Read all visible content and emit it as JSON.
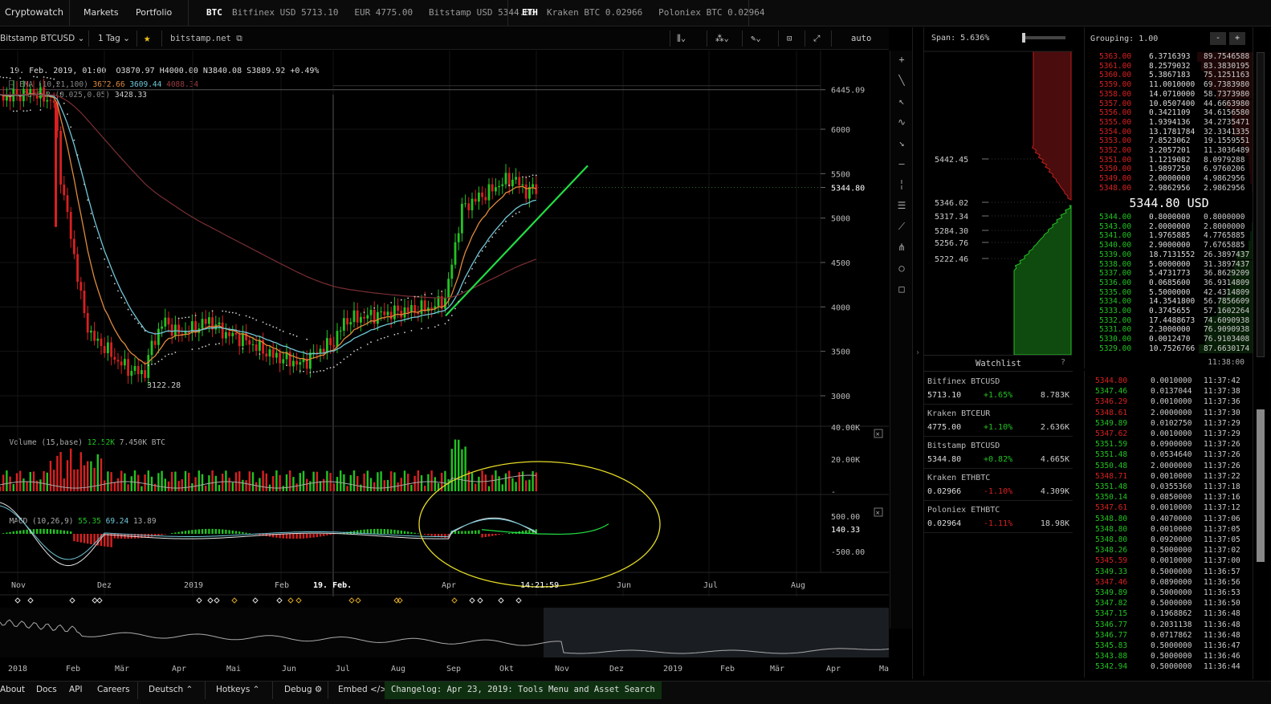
{
  "nav": {
    "brand": "Cryptowatch",
    "markets": "Markets",
    "portfolio": "Portfolio",
    "btc_label": "BTC",
    "btc_quotes": "Bitfinex USD 5713.10   EUR 4775.00   Bitstamp USD 5344.80",
    "eth_label": "ETH",
    "eth_quotes": "Kraken BTC 0.02966   Poloniex BTC 0.02964"
  },
  "toolbar": {
    "pair": "Bitstamp BTCUSD",
    "interval": "1 Tag",
    "exchange_link": "bitstamp.net",
    "auto": "auto"
  },
  "ohlc": {
    "date": "19. Feb. 2019, 01:00",
    "open": "O3870.97",
    "high": "H4000.00",
    "low": "N3840.08",
    "close": "S3889.92",
    "change": "+0.49%"
  },
  "indicators": {
    "ema_label": "EMA (10,21,100)",
    "ema1": "3672.66",
    "ema2": "3609.44",
    "ema3": "4088.34",
    "sar_label": "ParSAR (0.025,0.05)",
    "sar_value": "3428.33",
    "volume_label": "Volume (15,base)",
    "volume_v1": "12.52K",
    "volume_v2": "7.450K BTC",
    "macd_label": "MACD (10,26,9)",
    "macd_v1": "55.35",
    "macd_v2": "69.24",
    "macd_v3": "13.89"
  },
  "chart_data": {
    "type": "candlestick",
    "price_axis_ticks": [
      "6445.09",
      "6000",
      "5500",
      "5344.80",
      "5000",
      "4500",
      "4000",
      "3500",
      "3000"
    ],
    "low_marker": "3122.28",
    "volume_axis_ticks": [
      "40.00K",
      "20.00K",
      "-"
    ],
    "macd_axis_ticks": [
      "500.00",
      "140.33",
      "-500.00"
    ],
    "time_axis": [
      "Nov",
      "Dez",
      "2019",
      "Feb",
      "19. Feb.",
      "Apr",
      "14:21:59",
      "Jun",
      "Jul",
      "Aug"
    ],
    "overview_axis": [
      "2018",
      "Feb",
      "Mär",
      "Apr",
      "Mai",
      "Jun",
      "Jul",
      "Aug",
      "Sep",
      "Okt",
      "Nov",
      "Dez",
      "2019",
      "Feb",
      "Mär",
      "Apr",
      "Ma"
    ]
  },
  "depth": {
    "span_label": "Span: 5.636%",
    "prices": [
      "5442.45",
      "5346.02",
      "5317.34",
      "5284.30",
      "5256.76",
      "5222.46"
    ]
  },
  "watchlist": {
    "title": "Watchlist",
    "help": "?",
    "items": [
      {
        "name": "Bitfinex BTCUSD",
        "price": "5713.10",
        "change": "+1.65%",
        "vol": "8.783K",
        "up": true
      },
      {
        "name": "Kraken BTCEUR",
        "price": "4775.00",
        "change": "+1.10%",
        "vol": "2.636K",
        "up": true
      },
      {
        "name": "Bitstamp BTCUSD",
        "price": "5344.80",
        "change": "+0.82%",
        "vol": "4.665K",
        "up": true
      },
      {
        "name": "Kraken ETHBTC",
        "price": "0.02966",
        "change": "-1.10%",
        "vol": "4.309K",
        "up": false
      },
      {
        "name": "Poloniex ETHBTC",
        "price": "0.02964",
        "change": "-1.11%",
        "vol": "18.98K",
        "up": false
      }
    ]
  },
  "orderbook": {
    "grouping": "Grouping: 1.00",
    "minus": "-",
    "plus": "+",
    "mid_price": "5344.80 USD",
    "clock": "11:38:00",
    "asks": [
      [
        "5363.00",
        "6.3716393",
        "89.7546588"
      ],
      [
        "5361.00",
        "8.2579032",
        "83.3830195"
      ],
      [
        "5360.00",
        "5.3867183",
        "75.1251163"
      ],
      [
        "5359.00",
        "11.0010000",
        "69.7383980"
      ],
      [
        "5358.00",
        "14.0710000",
        "58.7373980"
      ],
      [
        "5357.00",
        "10.0507400",
        "44.6663980"
      ],
      [
        "5356.00",
        "0.3421109",
        "34.6156580"
      ],
      [
        "5355.00",
        "1.9394136",
        "34.2735471"
      ],
      [
        "5354.00",
        "13.1781784",
        "32.3341335"
      ],
      [
        "5353.00",
        "7.8523062",
        "19.1559551"
      ],
      [
        "5352.00",
        "3.2057201",
        "11.3036489"
      ],
      [
        "5351.00",
        "1.1219082",
        "8.0979288"
      ],
      [
        "5350.00",
        "1.9897250",
        "6.9760206"
      ],
      [
        "5349.00",
        "2.0000000",
        "4.9862956"
      ],
      [
        "5348.00",
        "2.9862956",
        "2.9862956"
      ]
    ],
    "bids": [
      [
        "5344.00",
        "0.8000000",
        "0.8000000"
      ],
      [
        "5343.00",
        "2.0000000",
        "2.8000000"
      ],
      [
        "5341.00",
        "1.9765885",
        "4.7765885"
      ],
      [
        "5340.00",
        "2.9000000",
        "7.6765885"
      ],
      [
        "5339.00",
        "18.7131552",
        "26.3897437"
      ],
      [
        "5338.00",
        "5.0000000",
        "31.3897437"
      ],
      [
        "5337.00",
        "5.4731773",
        "36.8629209"
      ],
      [
        "5336.00",
        "0.0685600",
        "36.9314809"
      ],
      [
        "5335.00",
        "5.5000000",
        "42.4314809"
      ],
      [
        "5334.00",
        "14.3541800",
        "56.7856609"
      ],
      [
        "5333.00",
        "0.3745655",
        "57.1602264"
      ],
      [
        "5332.00",
        "17.4488673",
        "74.6090938"
      ],
      [
        "5331.00",
        "2.3000000",
        "76.9090938"
      ],
      [
        "5330.00",
        "0.0012470",
        "76.9103408"
      ],
      [
        "5329.00",
        "10.7526766",
        "87.6630174"
      ]
    ]
  },
  "trades": [
    [
      "5344.80",
      "0.0010000",
      "11:37:42",
      false
    ],
    [
      "5347.46",
      "0.0137044",
      "11:37:38",
      true
    ],
    [
      "5346.29",
      "0.0010000",
      "11:37:36",
      false
    ],
    [
      "5348.61",
      "2.0000000",
      "11:37:30",
      false
    ],
    [
      "5349.89",
      "0.0102750",
      "11:37:29",
      true
    ],
    [
      "5347.62",
      "0.0010000",
      "11:37:29",
      false
    ],
    [
      "5351.59",
      "0.0900000",
      "11:37:26",
      true
    ],
    [
      "5351.48",
      "0.0534640",
      "11:37:26",
      true
    ],
    [
      "5350.48",
      "2.0000000",
      "11:37:26",
      true
    ],
    [
      "5348.71",
      "0.0010000",
      "11:37:22",
      false
    ],
    [
      "5351.48",
      "0.0355360",
      "11:37:18",
      true
    ],
    [
      "5350.14",
      "0.0850000",
      "11:37:16",
      true
    ],
    [
      "5347.61",
      "0.0010000",
      "11:37:12",
      false
    ],
    [
      "5348.80",
      "0.4070000",
      "11:37:06",
      true
    ],
    [
      "5348.80",
      "0.0010000",
      "11:37:05",
      true
    ],
    [
      "5348.80",
      "0.0920000",
      "11:37:05",
      true
    ],
    [
      "5348.26",
      "0.5000000",
      "11:37:02",
      true
    ],
    [
      "5345.59",
      "0.0010000",
      "11:37:00",
      false
    ],
    [
      "5349.33",
      "0.5000000",
      "11:36:57",
      true
    ],
    [
      "5347.46",
      "0.0890000",
      "11:36:56",
      false
    ],
    [
      "5349.89",
      "0.5000000",
      "11:36:53",
      true
    ],
    [
      "5347.82",
      "0.5000000",
      "11:36:50",
      true
    ],
    [
      "5347.15",
      "0.1968862",
      "11:36:48",
      true
    ],
    [
      "5346.77",
      "0.2031138",
      "11:36:48",
      true
    ],
    [
      "5346.77",
      "0.0717862",
      "11:36:48",
      true
    ],
    [
      "5345.83",
      "0.5000000",
      "11:36:47",
      true
    ],
    [
      "5343.88",
      "0.5000000",
      "11:36:46",
      true
    ],
    [
      "5342.94",
      "0.5000000",
      "11:36:44",
      true
    ]
  ],
  "footer": {
    "about": "About",
    "docs": "Docs",
    "api": "API",
    "careers": "Careers",
    "language": "Deutsch ⌃",
    "hotkeys": "Hotkeys ⌃",
    "debug": "Debug ⚙",
    "embed": "Embed </>",
    "changelog": "Changelog: Apr 23, 2019: Tools Menu and Asset Search"
  },
  "colors": {
    "up": "#22c322",
    "down": "#d92020",
    "ema_fast": "#e08a3c",
    "ema_mid": "#6fc7d8",
    "ema_slow": "#7a2f33",
    "trendline": "#22dd44",
    "annotation": "#e5dc26"
  }
}
